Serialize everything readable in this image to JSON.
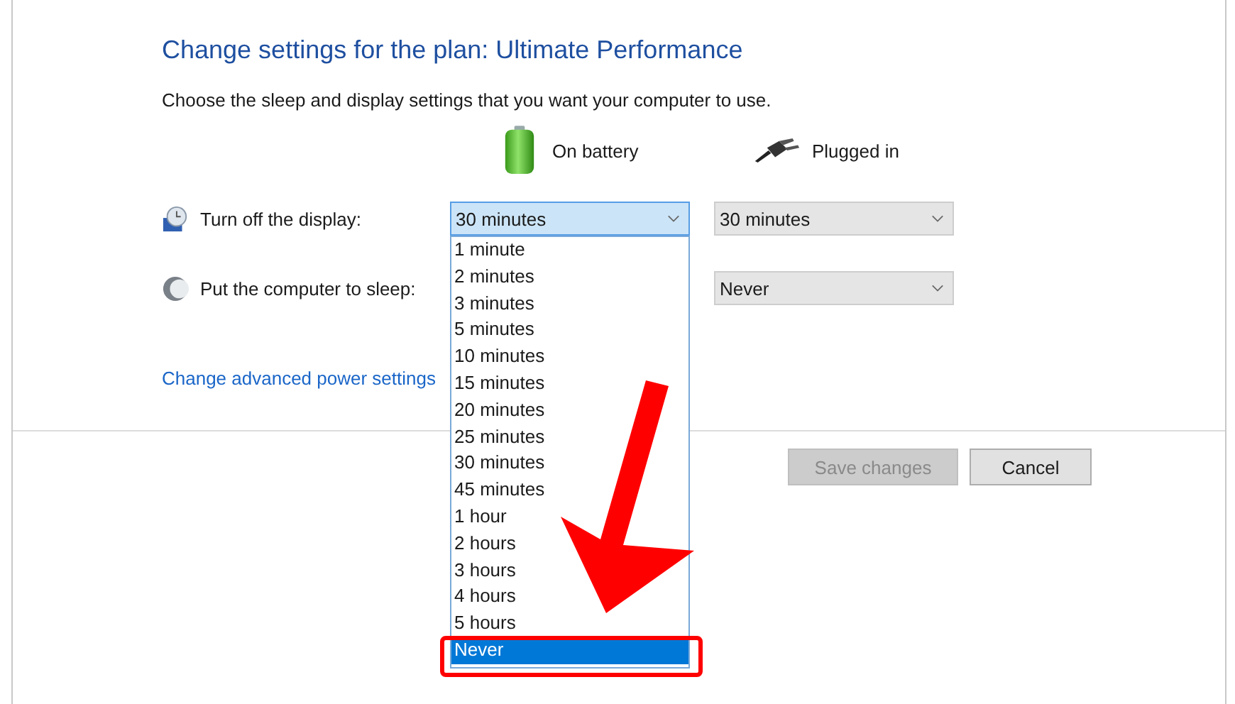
{
  "title": "Change settings for the plan: Ultimate Performance",
  "subtitle": "Choose the sleep and display settings that you want your computer to use.",
  "columns": [
    {
      "label": "On battery",
      "kind": "battery"
    },
    {
      "label": "Plugged in",
      "kind": "plug"
    }
  ],
  "settings": [
    {
      "label": "Turn off the display:",
      "kind": "display",
      "on_battery": {
        "value": "30 minutes",
        "expanded": true
      },
      "plugged_in": {
        "value": "30 minutes",
        "expanded": false
      }
    },
    {
      "label": "Put the computer to sleep:",
      "kind": "sleep",
      "plugged_in": {
        "value": "Never",
        "expanded": false
      }
    }
  ],
  "options": [
    {
      "label": "1 minute",
      "selected": false
    },
    {
      "label": "2 minutes",
      "selected": false
    },
    {
      "label": "3 minutes",
      "selected": false
    },
    {
      "label": "5 minutes",
      "selected": false
    },
    {
      "label": "10 minutes",
      "selected": false
    },
    {
      "label": "15 minutes",
      "selected": false
    },
    {
      "label": "20 minutes",
      "selected": false
    },
    {
      "label": "25 minutes",
      "selected": false
    },
    {
      "label": "30 minutes",
      "selected": false
    },
    {
      "label": "45 minutes",
      "selected": false
    },
    {
      "label": "1 hour",
      "selected": false
    },
    {
      "label": "2 hours",
      "selected": false
    },
    {
      "label": "3 hours",
      "selected": false
    },
    {
      "label": "4 hours",
      "selected": false
    },
    {
      "label": "5 hours",
      "selected": false
    },
    {
      "label": "Never",
      "selected": true
    }
  ],
  "link": "Change advanced power settings",
  "buttons": [
    {
      "label": "Save changes",
      "disabled": true
    },
    {
      "label": "Cancel",
      "disabled": false
    }
  ]
}
